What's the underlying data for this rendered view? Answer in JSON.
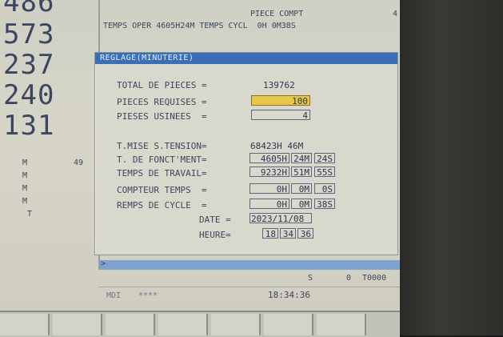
{
  "left_panel": {
    "big_numbers": [
      "486",
      "573",
      "237",
      "240",
      "131"
    ],
    "axis_labels": [
      "M",
      "M",
      "M",
      "M",
      "T"
    ],
    "axis_value_49": "49"
  },
  "top_bar": {
    "line1_a": "PIECE COMPT",
    "line1_b": "4",
    "line2": "TEMPS OPER 4605H24M TEMPS CYCL  0H 0M38S"
  },
  "dialog": {
    "title": "REGLAGE(MINUTERIE)",
    "total_pieces_label": "TOTAL DE PIECES =",
    "total_pieces_value": "139762",
    "pieces_requises_label": "PIECES REQUISES =",
    "pieces_requises_value": "100",
    "pieces_usinees_label": "PIESES USINEES  =",
    "pieces_usinees_value": "4",
    "mise_tension_label": "T.MISE S.TENSION=",
    "mise_tension_value": "68423H 46M",
    "fonct_label": "T. DE FONCT'MENT=",
    "fonct_h": "4605H",
    "fonct_m": "24M",
    "fonct_s": "24S",
    "travail_label": "TEMPS DE TRAVAIL=",
    "travail_h": "9232H",
    "travail_m": "51M",
    "travail_s": "55S",
    "compteur_label": "COMPTEUR TEMPS  =",
    "compteur_h": "0H",
    "compteur_m": "0M",
    "compteur_s": "0S",
    "cycle_label": "REMPS DE CYCLE  =",
    "cycle_h": "0H",
    "cycle_m": "0M",
    "cycle_s": "38S",
    "date_label": "DATE =",
    "date_value": "2023/11/08",
    "heure_label": "HEURE=",
    "heure_h": "18",
    "heure_m": "34",
    "heure_s": "36"
  },
  "status": {
    "arrow": ">",
    "s_label": "S",
    "s_value": "0",
    "tool": "T0000",
    "mode": "MDI",
    "stars": "****",
    "clock": "18:34:36"
  },
  "colors": {
    "title_bar": "#3a6fb8",
    "highlight": "#e8c74a",
    "screen_bg": "#d6d5c8"
  }
}
